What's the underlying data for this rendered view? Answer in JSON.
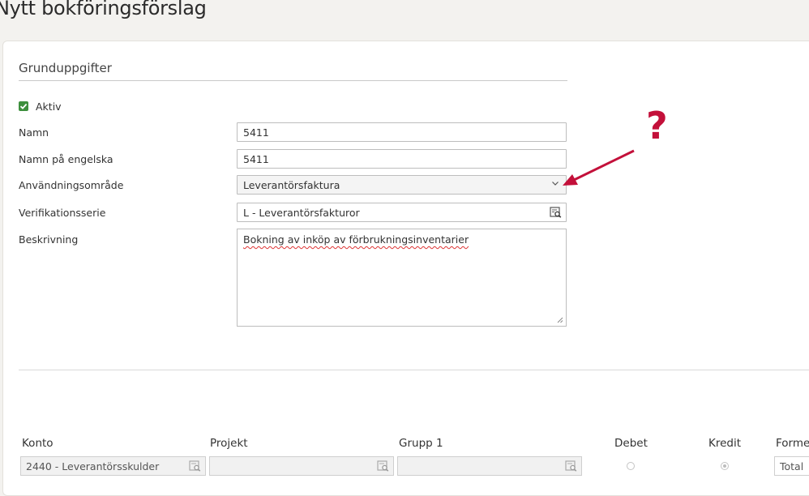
{
  "page": {
    "title": "Nytt bokföringsförslag"
  },
  "section": {
    "title": "Grunduppgifter"
  },
  "form": {
    "aktiv_label": "Aktiv",
    "aktiv_checked": true,
    "namn_label": "Namn",
    "namn_value": "5411",
    "namn_eng_label": "Namn på engelska",
    "namn_eng_value": "5411",
    "anvandning_label": "Användningsområde",
    "anvandning_value": "Leverantörsfaktura",
    "verifikation_label": "Verifikationsserie",
    "verifikation_value": "L - Leverantörsfakturor",
    "beskrivning_label": "Beskrivning",
    "beskrivning_value": "Bokning av  inköp av förbrukningsinventarier"
  },
  "grid": {
    "headers": {
      "konto": "Konto",
      "projekt": "Projekt",
      "grupp": "Grupp 1",
      "debet": "Debet",
      "kredit": "Kredit",
      "formel": "Forme"
    },
    "row": {
      "konto": "2440 - Leverantörsskulder",
      "projekt": "",
      "grupp": "",
      "debet": false,
      "kredit": true,
      "formel": "Total"
    }
  },
  "annotation": {
    "symbol": "?",
    "color": "#c3103a"
  },
  "icons": {
    "checkbox": "check-icon",
    "chevron": "chevron-down-icon",
    "lookup": "lookup-search-icon",
    "resize": "resize-grip-icon"
  }
}
